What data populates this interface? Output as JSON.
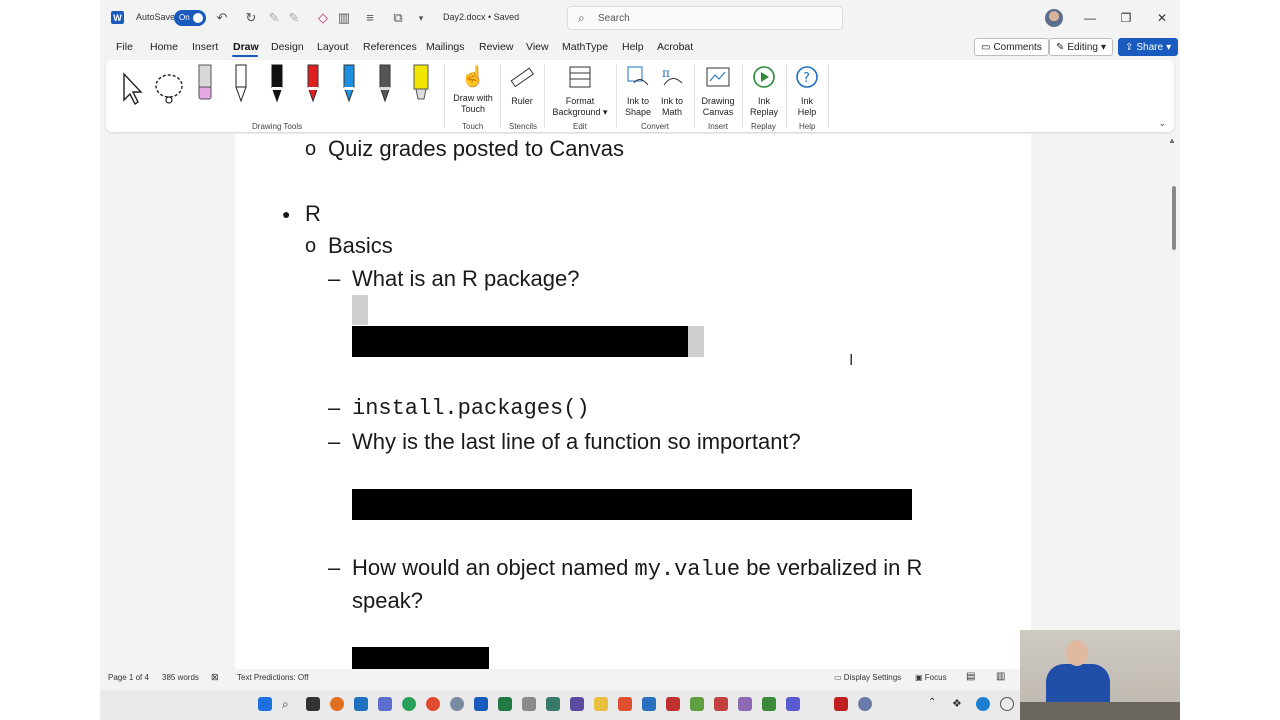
{
  "titlebar": {
    "autosave_label": "AutoSave",
    "autosave_state": "On",
    "document_title": "Day2.docx • Saved",
    "search_placeholder": "Search"
  },
  "menu": {
    "tabs": [
      "File",
      "Home",
      "Insert",
      "Draw",
      "Design",
      "Layout",
      "References",
      "Mailings",
      "Review",
      "View",
      "MathType",
      "Help",
      "Acrobat"
    ],
    "active_tab": "Draw",
    "comments_label": "Comments",
    "editing_label": "Editing",
    "share_label": "Share"
  },
  "ribbon": {
    "drawing_tools_label": "Drawing Tools",
    "draw_with_touch": [
      "Draw with",
      "Touch"
    ],
    "touch_label": "Touch",
    "ruler": "Ruler",
    "stencils_label": "Stencils",
    "format_background": [
      "Format",
      "Background"
    ],
    "edit_label": "Edit",
    "ink_to_shape": [
      "Ink to",
      "Shape"
    ],
    "ink_to_math": [
      "Ink to",
      "Math"
    ],
    "convert_label": "Convert",
    "drawing_canvas": [
      "Drawing",
      "Canvas"
    ],
    "insert_label": "Insert",
    "ink_replay": [
      "Ink",
      "Replay"
    ],
    "replay_label": "Replay",
    "ink_help": [
      "Ink",
      "Help"
    ],
    "help_label": "Help",
    "pen_colors": [
      "#111111",
      "#e02020",
      "#1e90e0",
      "#555555",
      "#f2e600"
    ]
  },
  "document": {
    "line1": "Quiz grades posted to Canvas",
    "line2": "R",
    "line3": "Basics",
    "line4": "What is an R package?",
    "line5": "install.packages()",
    "line6": "Why is the last line of a function so important?",
    "line7a": "How would an object named ",
    "line7b": "my.value",
    "line7c": " be verbalized in R",
    "line8": "speak?",
    "bullet_l1": "●",
    "bullet_l2": "o",
    "bullet_l3": "–"
  },
  "statusbar": {
    "page": "Page 1 of 4",
    "words": "385 words",
    "text_predictions": "Text Predictions: Off",
    "display_settings": "Display Settings",
    "focus": "Focus"
  }
}
